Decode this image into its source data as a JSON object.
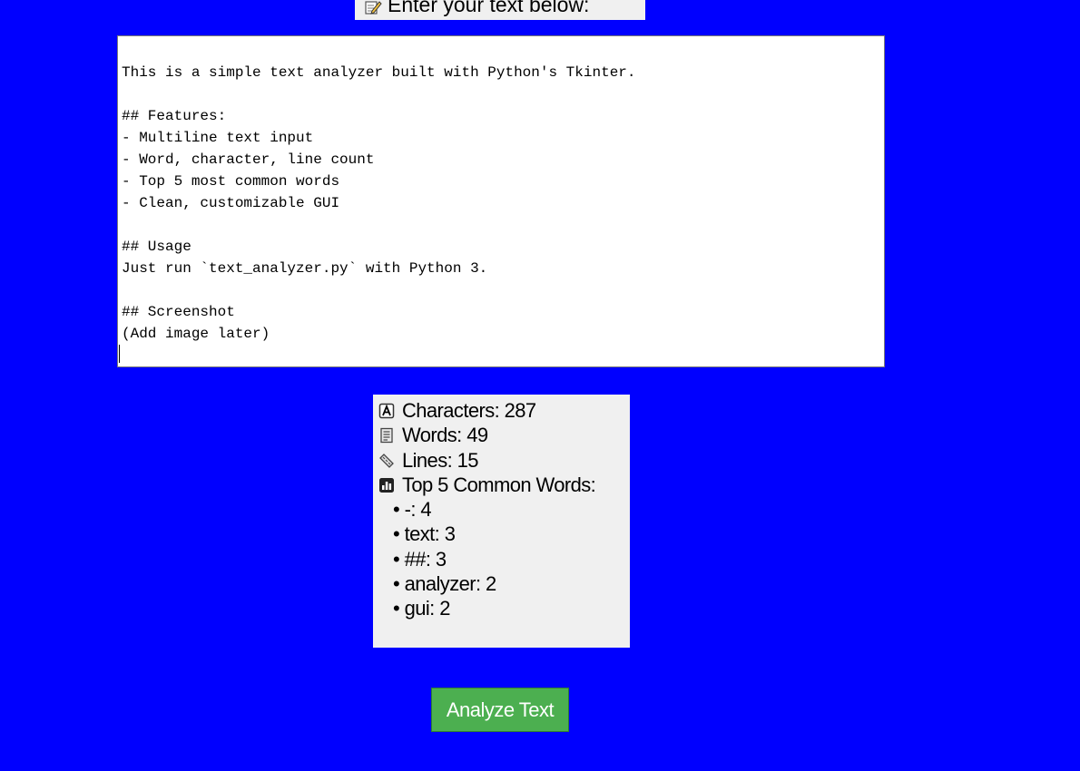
{
  "header": {
    "label": "Enter your text below:",
    "icon": "memo-pencil-icon"
  },
  "editor": {
    "value": "This is a simple text analyzer built with Python's Tkinter.\n\n## Features:\n- Multiline text input\n- Word, character, line count\n- Top 5 most common words\n- Clean, customizable GUI\n\n## Usage\nJust run `text_analyzer.py` with Python 3.\n\n## Screenshot\n(Add image later)\n"
  },
  "results": {
    "characters": {
      "icon": "letter-a-icon",
      "text": "Characters: 287"
    },
    "words": {
      "icon": "document-icon",
      "text": "Words: 49"
    },
    "lines": {
      "icon": "ruler-icon",
      "text": "Lines: 15"
    },
    "top_words": {
      "icon": "bar-chart-icon",
      "heading": "Top 5 Common Words:",
      "items": [
        "• -: 4",
        "• text: 3",
        "• ##: 3",
        "• analyzer: 2",
        "• gui: 2"
      ]
    }
  },
  "actions": {
    "analyze_label": "Analyze Text"
  },
  "colors": {
    "background": "#0000FF",
    "panel": "#F0F0F0",
    "button": "#4CAF50",
    "button_text": "#FFFFFF"
  }
}
